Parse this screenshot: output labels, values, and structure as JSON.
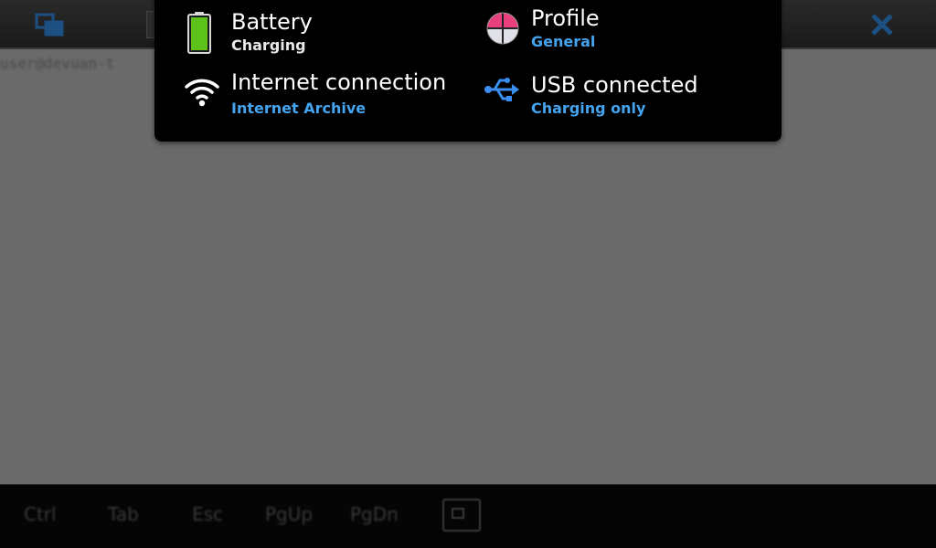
{
  "background_app": {
    "prompt_text": "user@devuan-t",
    "keys": [
      "Ctrl",
      "Tab",
      "Esc",
      "PgUp",
      "PgDn"
    ],
    "icons": [
      "window-switch-icon",
      "close-icon",
      "keyboard-toggle-icon"
    ]
  },
  "status_menu": {
    "battery": {
      "title": "Battery",
      "subtitle": "Charging",
      "icon": "battery-icon",
      "level": 1.0
    },
    "profile": {
      "title": "Profile",
      "subtitle": "General",
      "icon": "profile-icon"
    },
    "internet": {
      "title": "Internet connection",
      "subtitle": "Internet Archive",
      "icon": "wifi-icon"
    },
    "usb": {
      "title": "USB connected",
      "subtitle": "Charging only",
      "icon": "usb-icon"
    }
  },
  "colors": {
    "accent": "#44a4f0",
    "battery_fill": "#5cc21a",
    "profile_pink": "#e8407c",
    "usb_blue": "#3a8ef0",
    "menu_background": "#000000"
  }
}
